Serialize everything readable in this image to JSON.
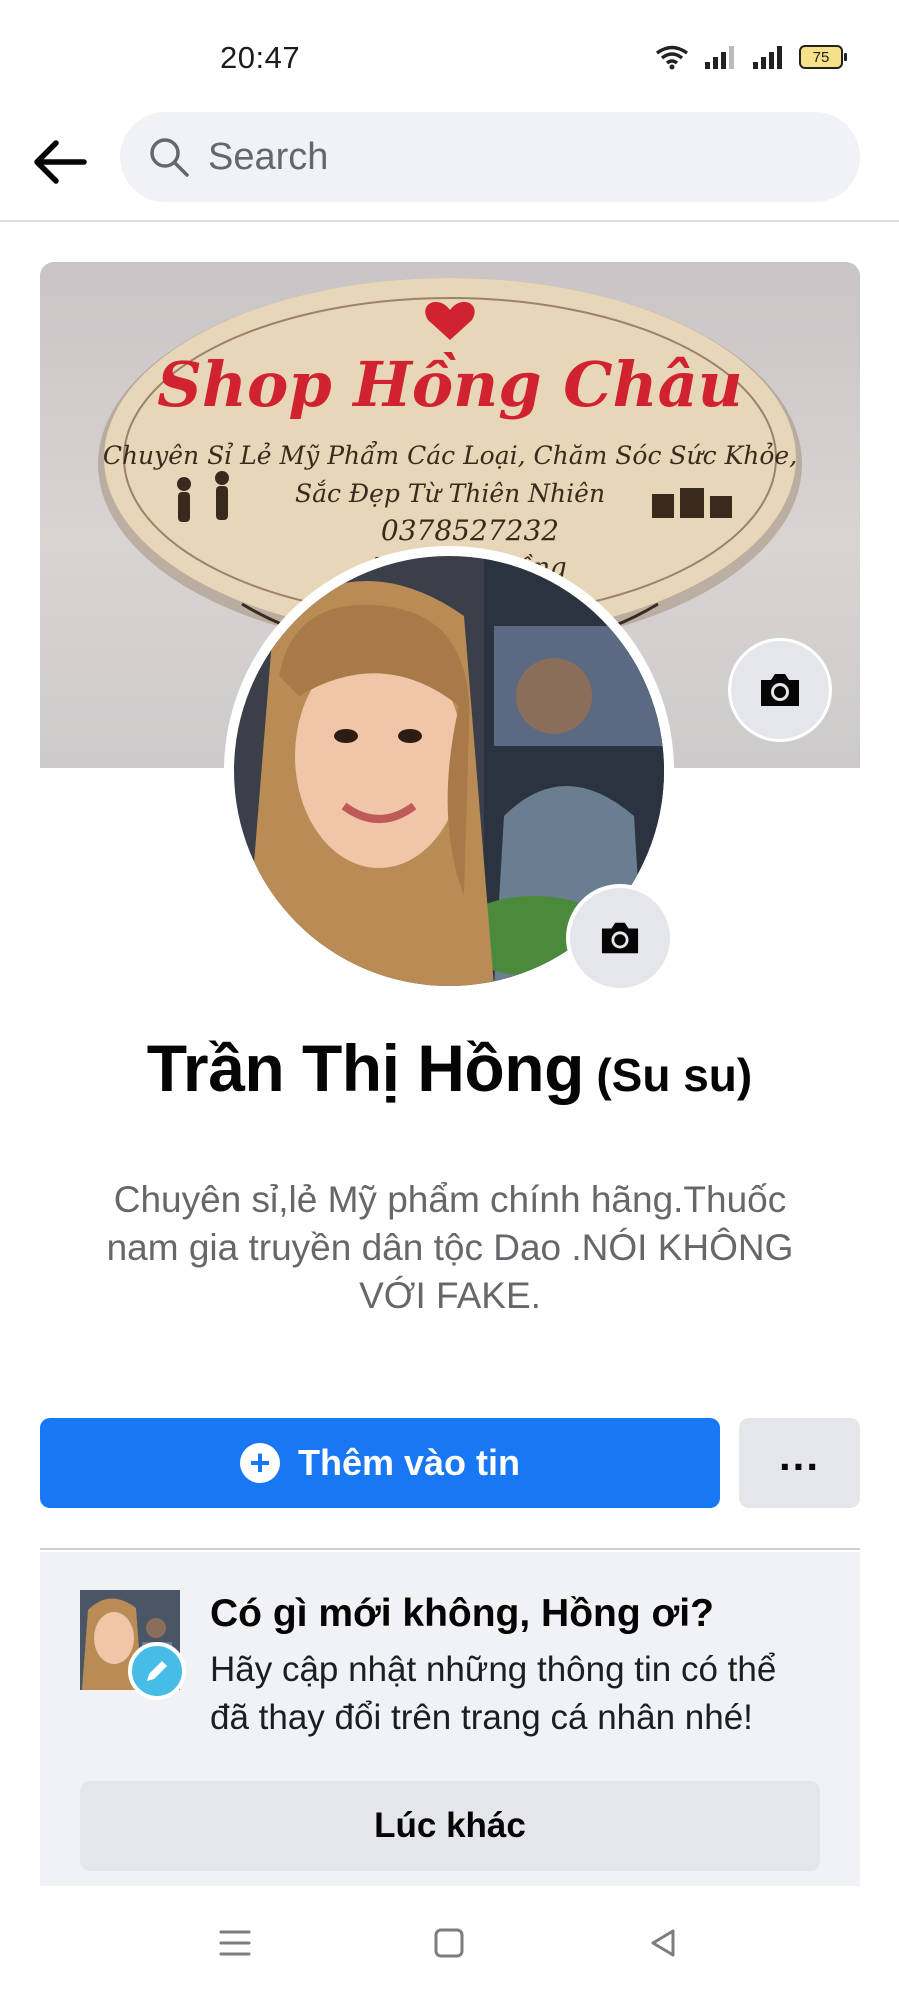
{
  "status_bar": {
    "time": "20:47",
    "battery": "75"
  },
  "header": {
    "search_placeholder": "Search"
  },
  "cover": {
    "sign_title": "Shop Hồng Châu",
    "sign_line1": "Chuyên Sỉ Lẻ Mỹ Phẩm Các Loại, Chăm Sóc Sức Khỏe,",
    "sign_line2": "Sắc Đẹp Từ Thiên Nhiên",
    "sign_phone": "0378527232",
    "sign_name": "Trần Thị Hồng"
  },
  "profile": {
    "name": "Trần Thị Hồng",
    "nickname": "(Su su)",
    "bio_lines": [
      "Chuyên sỉ,lẻ Mỹ phẩm chính hãng.Thuốc",
      "nam gia truyền dân tộc Dao .NÓI KHÔNG",
      "VỚI FAKE."
    ]
  },
  "actions": {
    "add_story": "Thêm vào tin",
    "more": "..."
  },
  "update_card": {
    "title": "Có gì mới không, Hồng ơi?",
    "body_lines": [
      "Hãy cập nhật những thông tin có thể",
      "đã thay đổi trên trang cá nhân nhé!"
    ],
    "later": "Lúc khác"
  },
  "colors": {
    "accent": "#1877f2",
    "sign_red": "#d1232f",
    "secondary_text": "#65676b"
  },
  "icons": [
    "wifi-icon",
    "signal-icon",
    "battery-icon",
    "back-arrow-icon",
    "search-icon",
    "camera-icon",
    "plus-icon",
    "more-icon",
    "pencil-icon",
    "menu-icon",
    "home-square-icon",
    "back-triangle-icon"
  ]
}
